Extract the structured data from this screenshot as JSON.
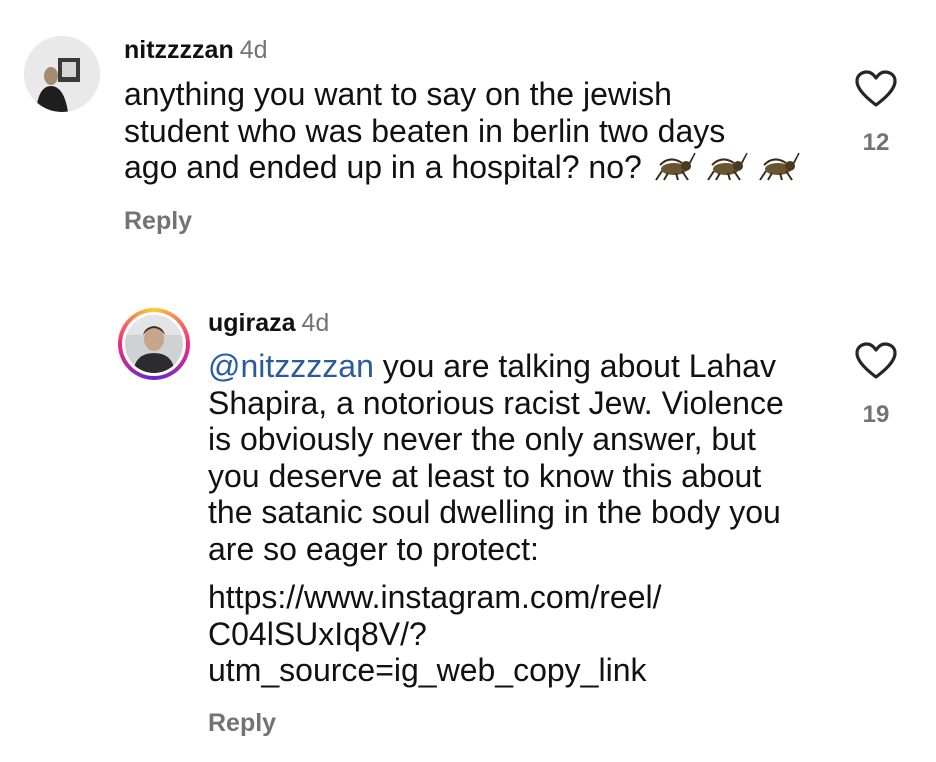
{
  "comment1": {
    "username": "nitzzzzan",
    "time": "4d",
    "lines": [
      "anything you want to say on the jewish",
      "student who was beaten  in berlin two days",
      "ago and ended up in a hospital? no?"
    ],
    "emoji": [
      "cricket-icon",
      "cricket-icon",
      "cricket-icon"
    ],
    "reply_label": "Reply",
    "likes": "12"
  },
  "comment2": {
    "username": "ugiraza",
    "time": "4d",
    "mention": "@nitzzzzan",
    "lines": [
      " you are talking about Lahav",
      "Shapira, a notorious racist Jew. Violence",
      "is obviously never the only answer, but",
      "you deserve at least to know this about",
      "the satanic soul dwelling in the body you",
      "are so eager to protect:"
    ],
    "link_lines": [
      "https://www.instagram.com/reel/",
      "C04lSUxIq8V/?",
      "utm_source=ig_web_copy_link"
    ],
    "reply_label": "Reply",
    "likes": "19"
  },
  "colors": {
    "text": "#111111",
    "secondary": "#737373",
    "mention": "#2a5a9e",
    "story_ring": [
      "#f9ce34",
      "#ee2a7b",
      "#6228d7"
    ]
  }
}
